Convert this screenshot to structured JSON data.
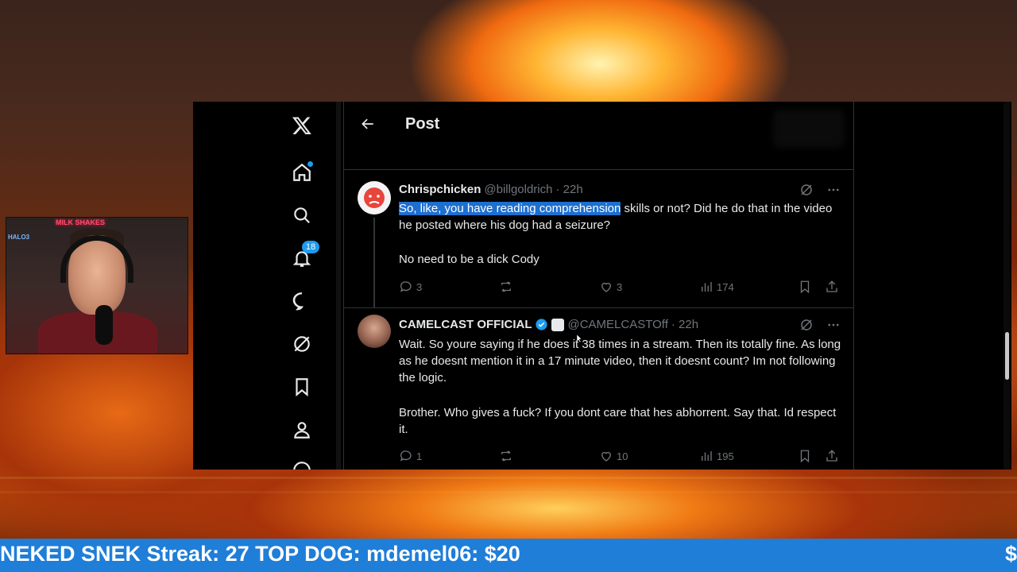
{
  "window": {
    "page_title": "Post"
  },
  "sidebar": {
    "notifications_badge": "18",
    "items": [
      {
        "icon": "x-logo-icon"
      },
      {
        "icon": "home-icon"
      },
      {
        "icon": "search-icon"
      },
      {
        "icon": "notifications-icon"
      },
      {
        "icon": "messages-icon"
      },
      {
        "icon": "grok-icon"
      },
      {
        "icon": "bookmarks-icon"
      },
      {
        "icon": "profile-icon"
      }
    ]
  },
  "tweets": [
    {
      "name": "Chrispchicken",
      "handle": "@billgoldrich",
      "time": "· 22h",
      "text_highlight": "So, like, you have reading comprehension",
      "text_rest": " skills or not? Did he do that in the video he posted where his dog had a seizure?",
      "text_p2": "No need to be a dick Cody",
      "replies": "3",
      "reposts": "",
      "likes": "3",
      "views": "174"
    },
    {
      "name": "CAMELCAST OFFICIAL",
      "handle": "@CAMELCASTOff",
      "time": "· 22h",
      "text_p1": "Wait. So youre saying if he does it 38 times in a stream. Then its totally fine. As long as he doesnt mention it in a 17 minute video, then it doesnt count? Im not following the logic.",
      "text_p2": "Brother. Who gives a fuck? If you dont care that hes abhorrent. Say that. Id respect it.",
      "replies": "1",
      "reposts": "",
      "likes": "10",
      "views": "195"
    }
  ],
  "webcam": {
    "sign": "MILK SHAKES",
    "poster": "HALO3"
  },
  "ticker": {
    "text": "NEKED SNEK Streak: 27 TOP DOG: mdemel06: $20",
    "end": "$"
  },
  "colors": {
    "accent": "#1d9bf0",
    "ticker_bg": "#1f7ed8",
    "highlight": "#1d6fd0"
  }
}
